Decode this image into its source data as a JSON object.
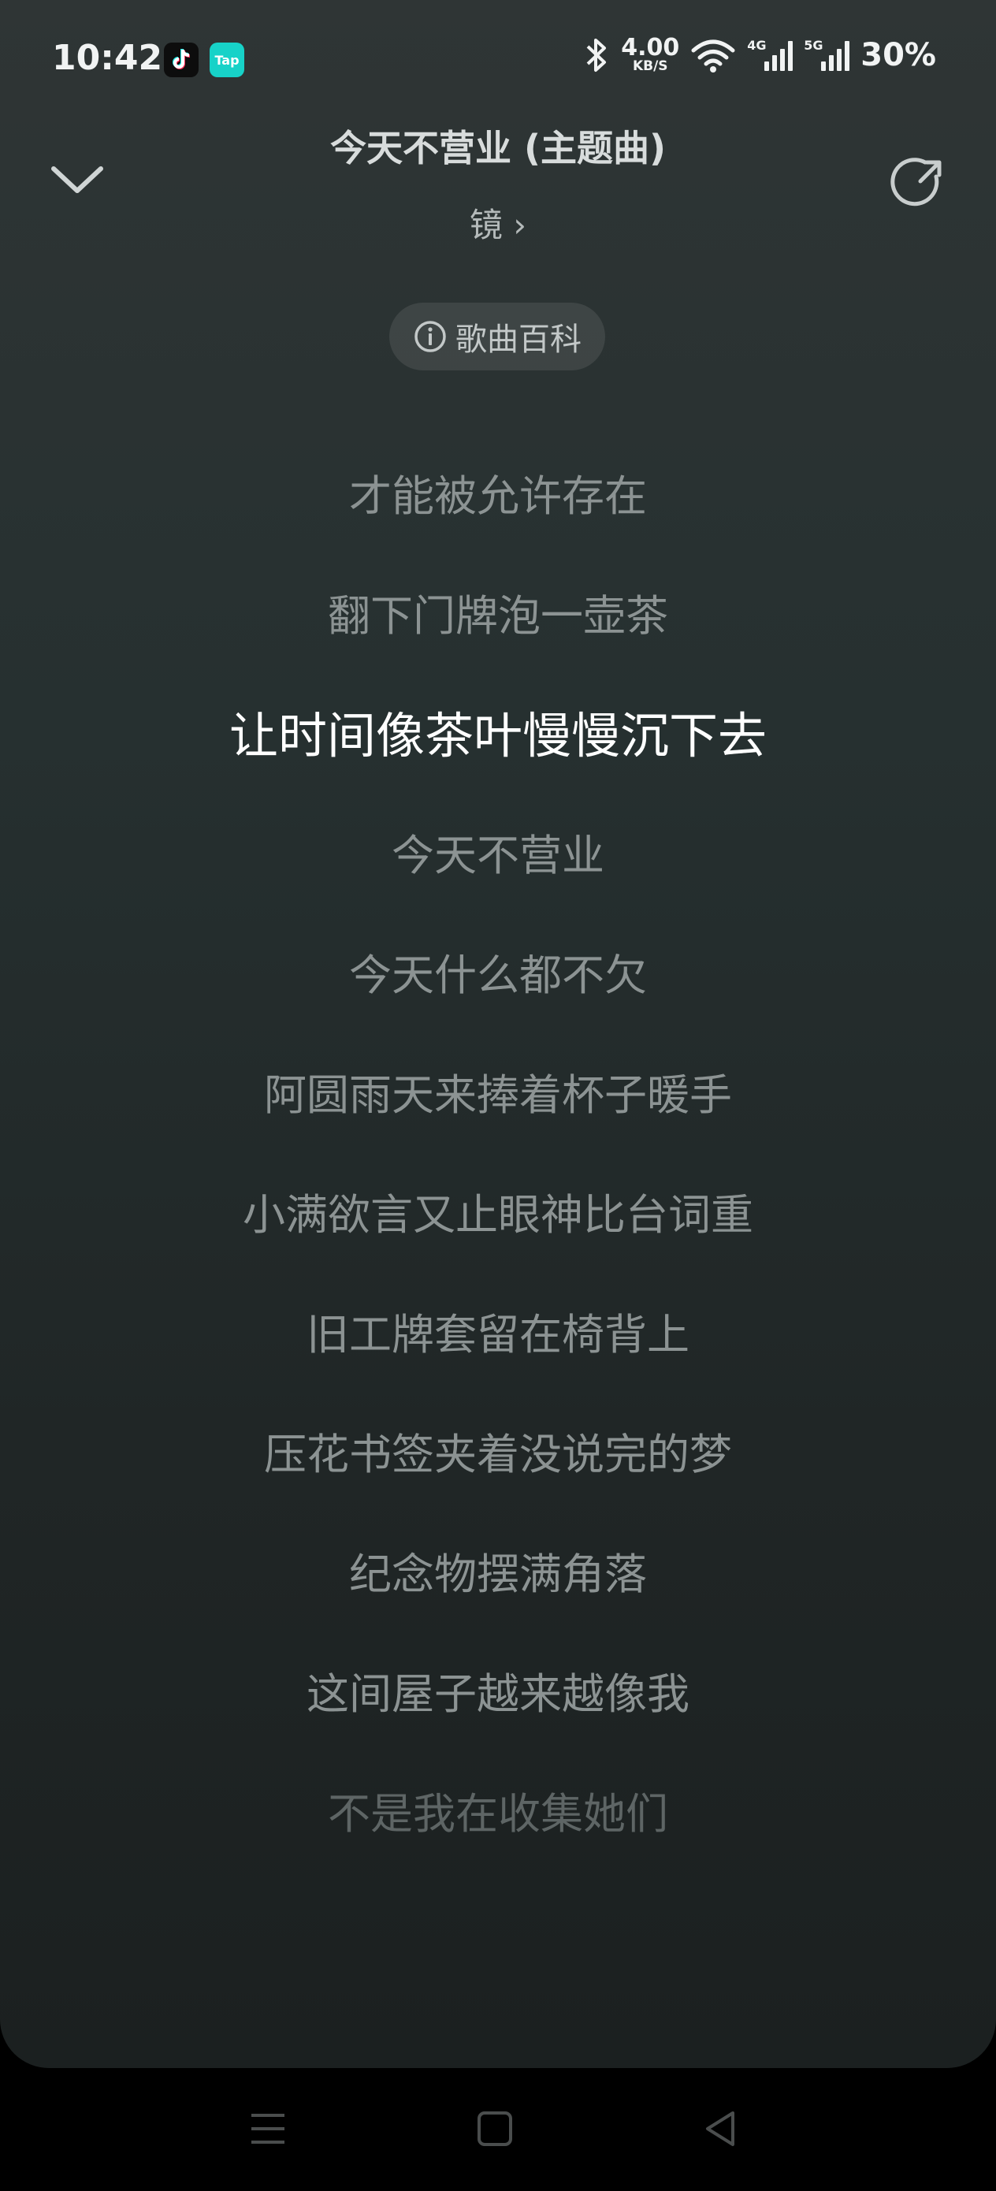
{
  "status_bar": {
    "time": "10:42",
    "net_speed_value": "4.00",
    "net_speed_unit": "KB/S",
    "sim1_label": "4G",
    "sim2_label": "5G",
    "battery": "30%",
    "apps": [
      "tiktok-icon",
      "taptap-icon"
    ],
    "taptap_text": "Tap"
  },
  "header": {
    "title": "今天不营业 (主题曲)",
    "artist": "镜 ›",
    "wiki_label": "歌曲百科"
  },
  "lyrics": [
    "才能被允许存在",
    "翻下门牌泡一壶茶",
    "让时间像茶叶慢慢沉下去",
    "今天不营业",
    "今天什么都不欠",
    "阿圆雨天来捧着杯子暖手",
    "小满欲言又止眼神比台词重",
    "旧工牌套留在椅背上",
    "压花书签夹着没说完的梦",
    "纪念物摆满角落",
    "这间屋子越来越像我",
    "不是我在收集她们"
  ],
  "current_lyric_index": 2,
  "colors": {
    "background_top": "#2f3535",
    "background_bottom": "#1b2020",
    "current_lyric": "#ffffff",
    "other_lyric": "#8c9393"
  }
}
